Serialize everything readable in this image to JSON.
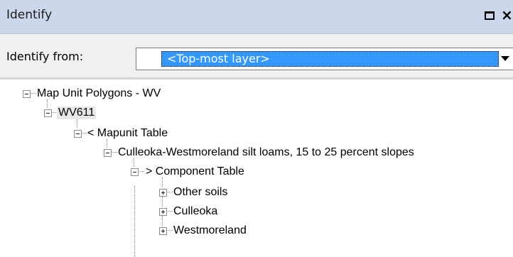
{
  "window": {
    "title": "Identify",
    "close_glyph": "×"
  },
  "identify_from": {
    "label": "Identify from:",
    "selected_value": "<Top-most layer>"
  },
  "tree": {
    "nodes": [
      {
        "label": "Map Unit Polygons - WV",
        "state": "expanded"
      },
      {
        "label": "WV611",
        "state": "expanded",
        "highlighted": true
      },
      {
        "label": "< Mapunit Table",
        "state": "expanded"
      },
      {
        "label": "Culleoka-Westmoreland silt loams, 15 to 25 percent slopes",
        "state": "expanded"
      },
      {
        "label": "> Component Table",
        "state": "expanded"
      },
      {
        "label": "Other soils",
        "state": "collapsed"
      },
      {
        "label": "Culleoka",
        "state": "collapsed"
      },
      {
        "label": "Westmoreland",
        "state": "collapsed"
      }
    ]
  }
}
